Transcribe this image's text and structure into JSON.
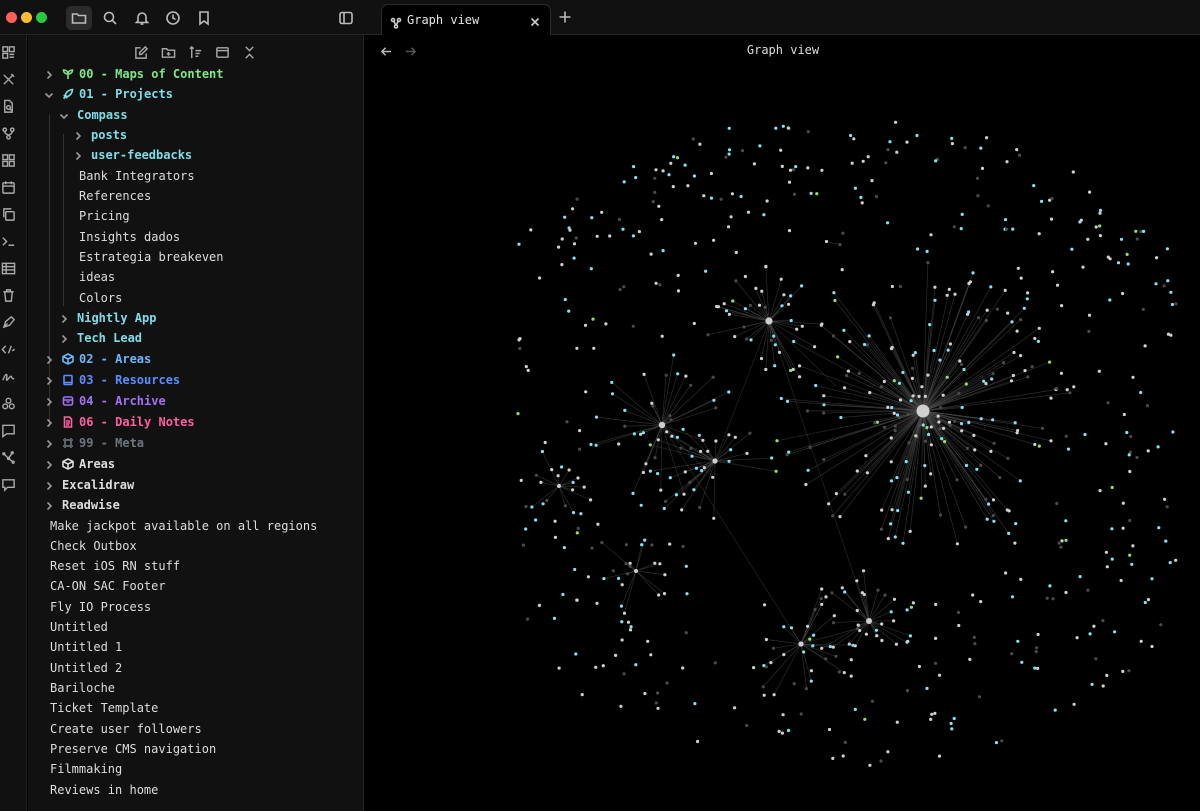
{
  "tab": {
    "label": "Graph view"
  },
  "graph": {
    "title": "Graph view"
  },
  "colors": {
    "maps": "#7ee787",
    "projects": "#7ddde8",
    "areas": "#6cb6ff",
    "resources": "#5b8dff",
    "archive": "#a371f7",
    "daily": "#ff5fa2",
    "meta": "#6e7681",
    "text": "#dcddde",
    "node_white": "#d0d0d0",
    "node_cyan": "#7fe3f5",
    "node_green": "#8fe06b",
    "node_gray": "#4a4a4a"
  },
  "top_icons": [
    "folder-icon",
    "search-icon",
    "bell-icon",
    "clock-icon",
    "bookmark-icon"
  ],
  "sidebar": {
    "tree": [
      {
        "label": "00 - Maps of Content",
        "icon": "sprout-icon",
        "color": "#7ee787",
        "bold": true,
        "chev": "right"
      },
      {
        "label": "01 - Projects",
        "icon": "rocket-icon",
        "color": "#7ddde8",
        "bold": true,
        "chev": "down"
      },
      {
        "label": "Compass",
        "color": "#7ddde8",
        "bold": true,
        "chev": "down"
      },
      {
        "label": "posts",
        "color": "#7ddde8",
        "bold": true,
        "chev": "right"
      },
      {
        "label": "user-feedbacks",
        "color": "#7ddde8",
        "bold": true,
        "chev": "right"
      },
      {
        "label": "Bank Integrators"
      },
      {
        "label": "References"
      },
      {
        "label": "Pricing"
      },
      {
        "label": "Insights dados"
      },
      {
        "label": "Estrategia breakeven"
      },
      {
        "label": "ideas"
      },
      {
        "label": "Colors"
      },
      {
        "label": "Nightly App",
        "color": "#7ddde8",
        "bold": true,
        "chev": "right"
      },
      {
        "label": "Tech Lead",
        "color": "#7ddde8",
        "bold": true,
        "chev": "right"
      },
      {
        "label": "02 - Areas",
        "icon": "box-icon",
        "color": "#6cb6ff",
        "bold": true,
        "chev": "right"
      },
      {
        "label": "03 - Resources",
        "icon": "book-icon",
        "color": "#5b8dff",
        "bold": true,
        "chev": "right"
      },
      {
        "label": "04 - Archive",
        "icon": "archive-icon",
        "color": "#a371f7",
        "bold": true,
        "chev": "right"
      },
      {
        "label": "06 - Daily Notes",
        "icon": "file-icon",
        "color": "#ff5fa2",
        "bold": true,
        "chev": "right"
      },
      {
        "label": "99 - Meta",
        "icon": "frame-icon",
        "color": "#6e7681",
        "bold": true,
        "chev": "right"
      },
      {
        "label": "Areas",
        "icon": "box-icon",
        "color": "#dcddde",
        "bold": true,
        "chev": "right"
      },
      {
        "label": "Excalidraw",
        "color": "#dcddde",
        "bold": true,
        "chev": "right"
      },
      {
        "label": "Readwise",
        "color": "#dcddde",
        "bold": true,
        "chev": "right"
      },
      {
        "label": "Make jackpot available on all regions"
      },
      {
        "label": "Check Outbox"
      },
      {
        "label": "Reset iOS RN stuff"
      },
      {
        "label": "CA-ON SAC Footer"
      },
      {
        "label": "Fly IO Process"
      },
      {
        "label": "Untitled"
      },
      {
        "label": "Untitled 1"
      },
      {
        "label": "Untitled 2"
      },
      {
        "label": "Bariloche"
      },
      {
        "label": "Ticket Template"
      },
      {
        "label": "Create user followers"
      },
      {
        "label": "Preserve CMS navigation"
      },
      {
        "label": "Filmmaking"
      },
      {
        "label": "Reviews in home"
      }
    ]
  }
}
